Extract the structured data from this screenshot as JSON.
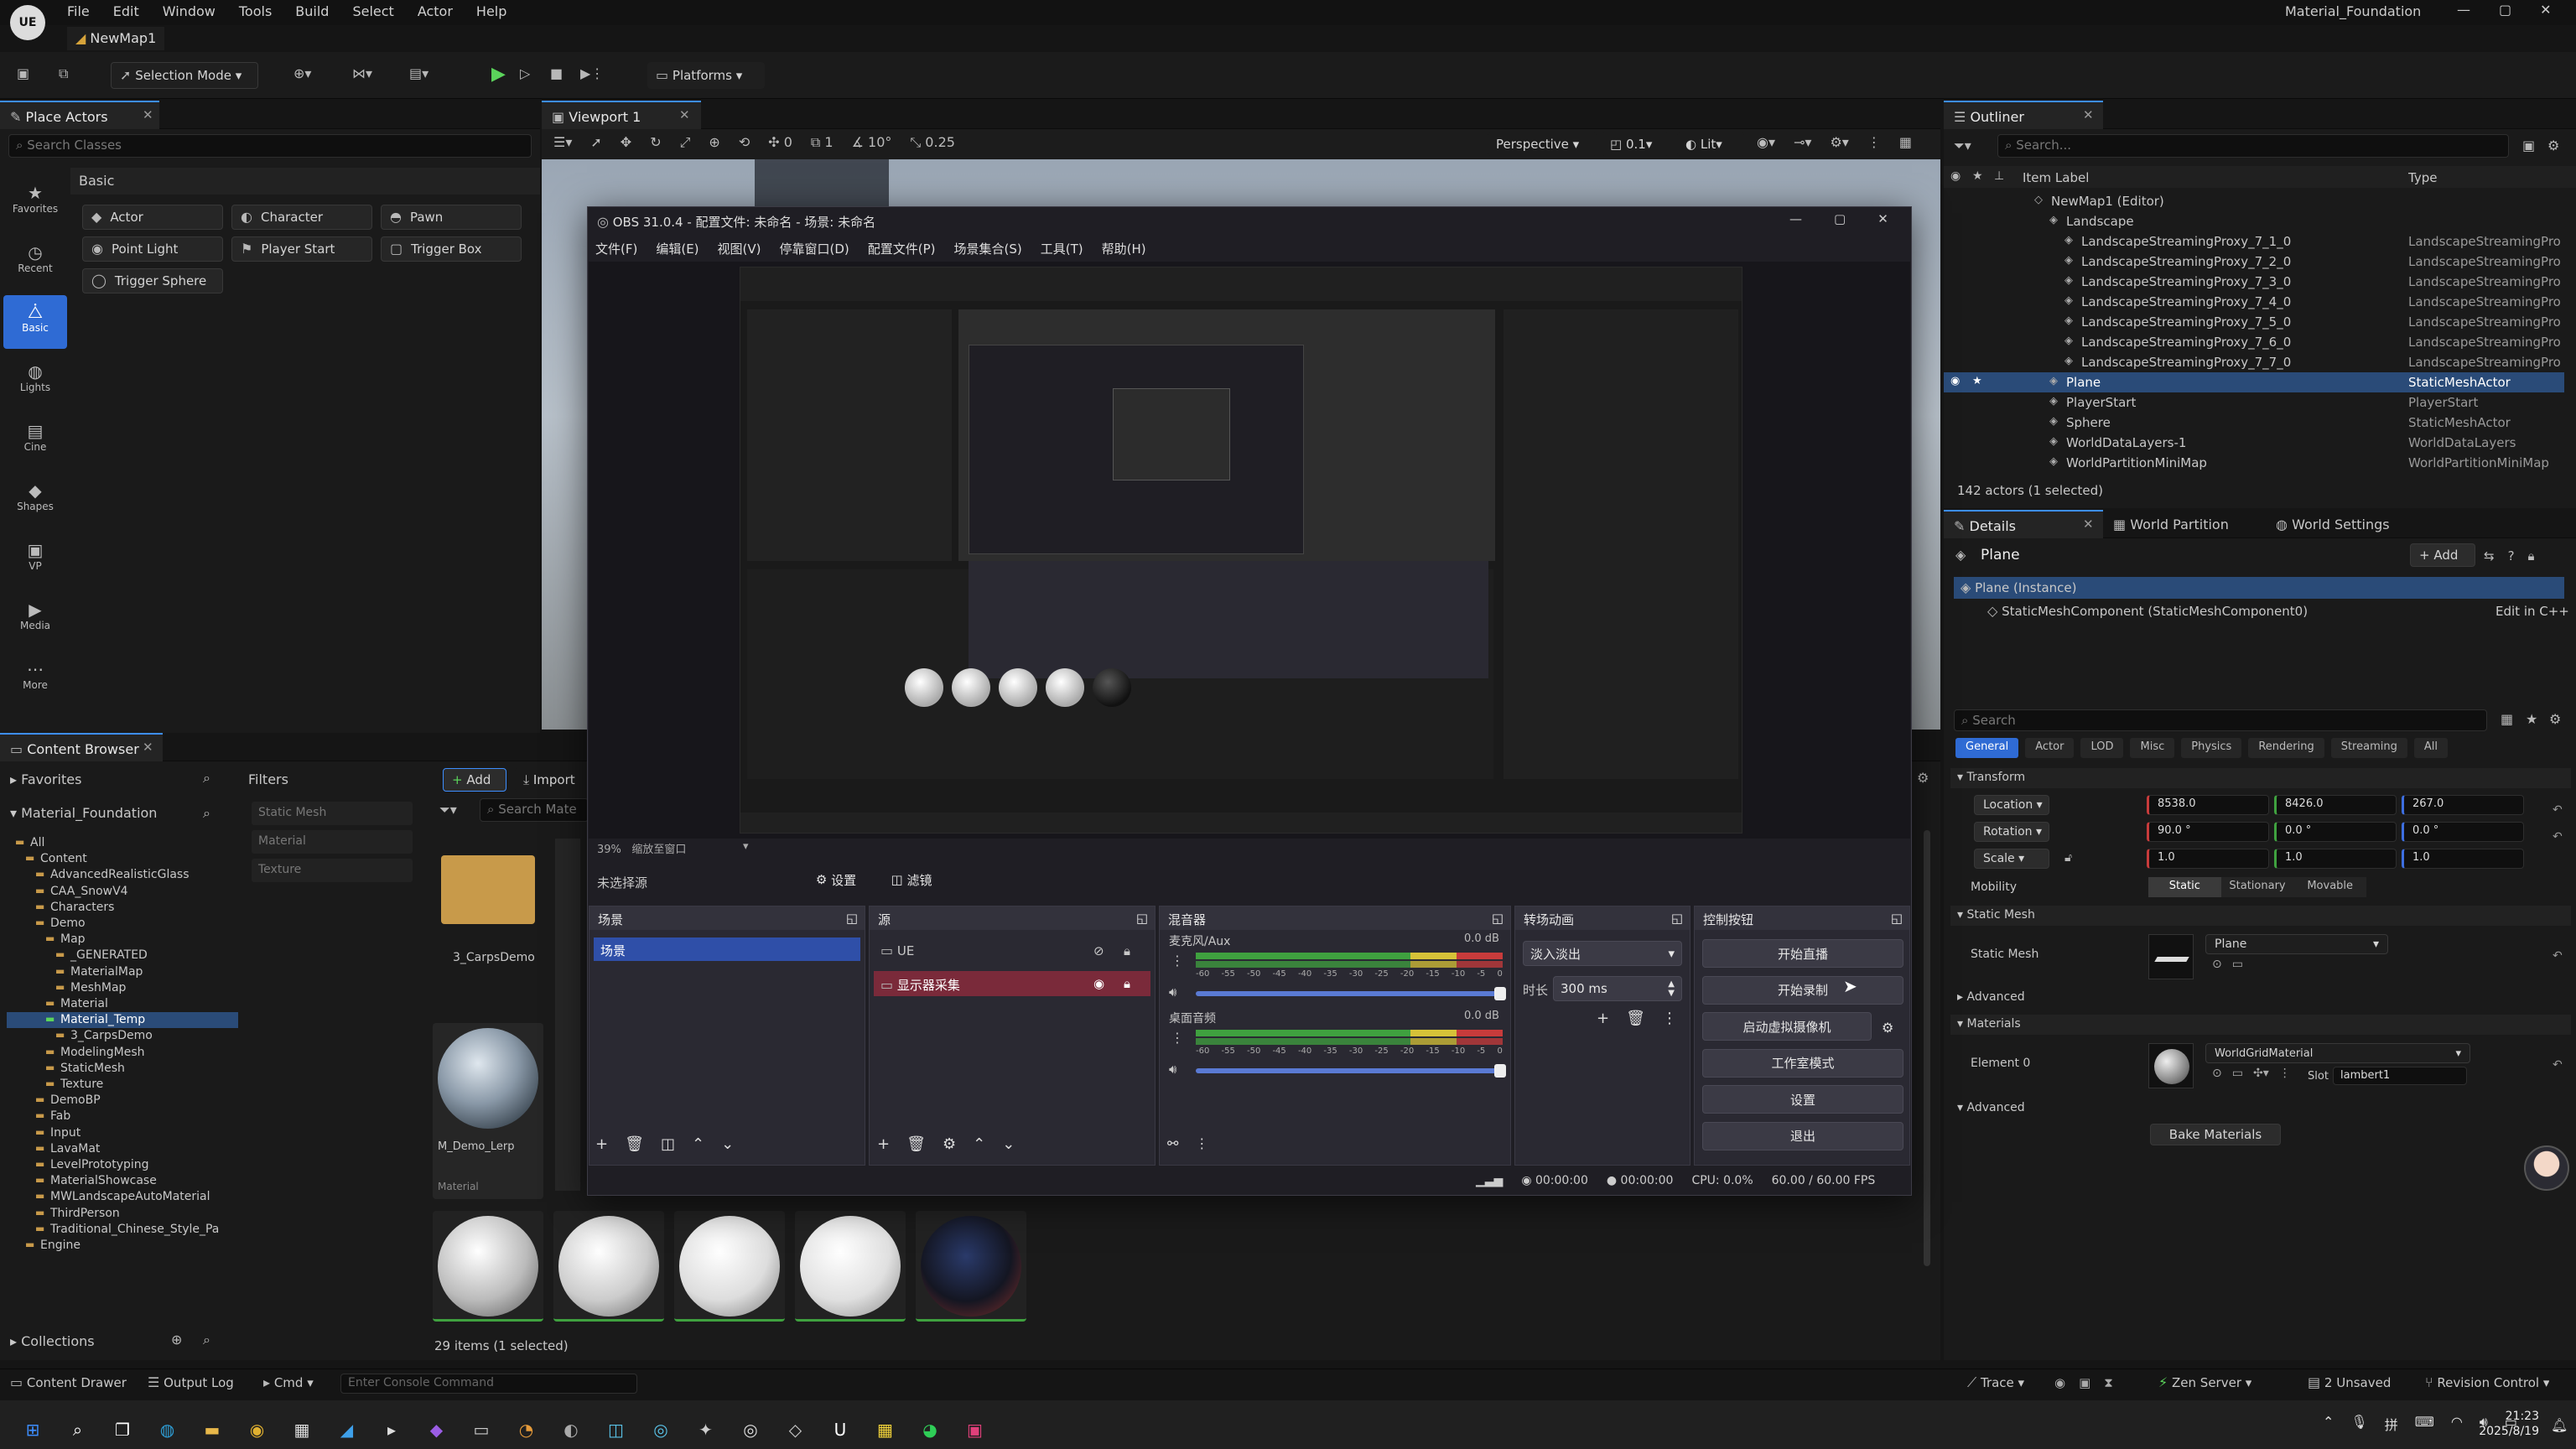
{
  "app": {
    "logo": "UE",
    "menus": [
      "File",
      "Edit",
      "Window",
      "Tools",
      "Build",
      "Select",
      "Actor",
      "Help"
    ],
    "project": "Material_Foundation",
    "map_tab": "NewMap1"
  },
  "toolbar": {
    "mode": "Selection Mode",
    "platforms": "Platforms"
  },
  "place_actors": {
    "tab": "Place Actors",
    "search_placeholder": "Search Classes",
    "category": "Basic",
    "sidebar": [
      {
        "label": "Favorites",
        "icon": "star-icon"
      },
      {
        "label": "Recent",
        "icon": "clock-icon"
      },
      {
        "label": "Basic",
        "icon": "basic-icon"
      },
      {
        "label": "Lights",
        "icon": "light-icon"
      },
      {
        "label": "Cine",
        "icon": "camera-icon"
      },
      {
        "label": "Shapes",
        "icon": "shapes-icon"
      },
      {
        "label": "VP",
        "icon": "vp-icon"
      },
      {
        "label": "Media",
        "icon": "media-icon"
      },
      {
        "label": "More",
        "icon": "more-icon"
      }
    ],
    "items": [
      "Actor",
      "Character",
      "Pawn",
      "Point Light",
      "Player Start",
      "Trigger Box",
      "Trigger Sphere"
    ]
  },
  "viewport": {
    "tab": "Viewport 1",
    "perspective": "Perspective",
    "lit": "Lit",
    "fov": "0.1",
    "snap_grid": "0",
    "snap_rot": "10°",
    "snap_scale": "0.25",
    "one": "1"
  },
  "outliner": {
    "tab": "Outliner",
    "search_placeholder": "Search...",
    "col_label": "Item Label",
    "col_type": "Type",
    "rows": [
      {
        "label": "NewMap1 (Editor)",
        "type": "",
        "indent": 0
      },
      {
        "label": "Landscape",
        "type": "",
        "indent": 1
      },
      {
        "label": "LandscapeStreamingProxy_7_1_0",
        "type": "LandscapeStreamingPro",
        "indent": 2
      },
      {
        "label": "LandscapeStreamingProxy_7_2_0",
        "type": "LandscapeStreamingPro",
        "indent": 2
      },
      {
        "label": "LandscapeStreamingProxy_7_3_0",
        "type": "LandscapeStreamingPro",
        "indent": 2
      },
      {
        "label": "LandscapeStreamingProxy_7_4_0",
        "type": "LandscapeStreamingPro",
        "indent": 2
      },
      {
        "label": "LandscapeStreamingProxy_7_5_0",
        "type": "LandscapeStreamingPro",
        "indent": 2
      },
      {
        "label": "LandscapeStreamingProxy_7_6_0",
        "type": "LandscapeStreamingPro",
        "indent": 2
      },
      {
        "label": "LandscapeStreamingProxy_7_7_0",
        "type": "LandscapeStreamingPro",
        "indent": 2
      },
      {
        "label": "Plane",
        "type": "StaticMeshActor",
        "indent": 1,
        "selected": true
      },
      {
        "label": "PlayerStart",
        "type": "PlayerStart",
        "indent": 1
      },
      {
        "label": "Sphere",
        "type": "StaticMeshActor",
        "indent": 1
      },
      {
        "label": "WorldDataLayers-1",
        "type": "WorldDataLayers",
        "indent": 1
      },
      {
        "label": "WorldPartitionMiniMap",
        "type": "WorldPartitionMiniMap",
        "indent": 1
      }
    ],
    "status": "142 actors (1 selected)"
  },
  "details": {
    "tabs": [
      "Details",
      "World Partition",
      "World Settings"
    ],
    "object": "Plane",
    "add": "Add",
    "instance": "Plane (Instance)",
    "component": "StaticMeshComponent (StaticMeshComponent0)",
    "edit_cpp": "Edit in C++",
    "search_placeholder": "Search",
    "filter_tabs": [
      "General",
      "Actor",
      "LOD",
      "Misc",
      "Physics",
      "Rendering",
      "Streaming",
      "All"
    ],
    "transform": "Transform",
    "location": "Location",
    "rotation": "Rotation",
    "scale": "Scale",
    "loc": [
      "8538.0",
      "8426.0",
      "267.0"
    ],
    "rot": [
      "90.0 °",
      "0.0 °",
      "0.0 °"
    ],
    "scl": [
      "1.0",
      "1.0",
      "1.0"
    ],
    "mobility": "Mobility",
    "mob_opts": [
      "Static",
      "Stationary",
      "Movable"
    ],
    "static_mesh_section": "Static Mesh",
    "static_mesh_label": "Static Mesh",
    "mesh_value": "Plane",
    "advanced": "Advanced",
    "materials": "Materials",
    "element0": "Element 0",
    "material_value": "WorldGridMaterial",
    "slot": "Slot",
    "slot_value": "lambert1",
    "bake": "Bake Materials"
  },
  "content_browser": {
    "tab": "Content Browser",
    "favorites": "Favorites",
    "project": "Material_Foundation",
    "filters": "Filters",
    "add": "Add",
    "import": "Import",
    "search_placeholder": "Search Mate",
    "filter_items": [
      "Static Mesh",
      "Material",
      "Texture"
    ],
    "tree": [
      {
        "label": "All",
        "indent": 0
      },
      {
        "label": "Content",
        "indent": 1
      },
      {
        "label": "AdvancedRealisticGlass",
        "indent": 2
      },
      {
        "label": "CAA_SnowV4",
        "indent": 2
      },
      {
        "label": "Characters",
        "indent": 2
      },
      {
        "label": "Demo",
        "indent": 2
      },
      {
        "label": "Map",
        "indent": 3
      },
      {
        "label": "_GENERATED",
        "indent": 4
      },
      {
        "label": "MaterialMap",
        "indent": 4
      },
      {
        "label": "MeshMap",
        "indent": 4
      },
      {
        "label": "Material",
        "indent": 3
      },
      {
        "label": "Material_Temp",
        "indent": 3,
        "selected": true
      },
      {
        "label": "3_CarpsDemo",
        "indent": 4
      },
      {
        "label": "ModelingMesh",
        "indent": 3
      },
      {
        "label": "StaticMesh",
        "indent": 3
      },
      {
        "label": "Texture",
        "indent": 3
      },
      {
        "label": "DemoBP",
        "indent": 2
      },
      {
        "label": "Fab",
        "indent": 2
      },
      {
        "label": "Input",
        "indent": 2
      },
      {
        "label": "LavaMat",
        "indent": 2
      },
      {
        "label": "LevelPrototyping",
        "indent": 2
      },
      {
        "label": "MaterialShowcase",
        "indent": 2
      },
      {
        "label": "MWLandscapeAutoMaterial",
        "indent": 2
      },
      {
        "label": "ThirdPerson",
        "indent": 2
      },
      {
        "label": "Traditional_Chinese_Style_Pa",
        "indent": 2
      },
      {
        "label": "Engine",
        "indent": 1
      }
    ],
    "assets": [
      {
        "label": "3_CarpsDemo",
        "type": ""
      },
      {
        "label": "M_Demo_Lerp",
        "type": "Material"
      }
    ],
    "collections": "Collections",
    "status": "29 items (1 selected)"
  },
  "obs": {
    "title": "OBS 31.0.4 - 配置文件: 未命名 - 场景: 未命名",
    "menus": [
      "文件(F)",
      "编辑(E)",
      "视图(V)",
      "停靠窗口(D)",
      "配置文件(P)",
      "场景集合(S)",
      "工具(T)",
      "帮助(H)"
    ],
    "zoom": "39%",
    "zoom_label": "缩放至窗口",
    "no_source": "未选择源",
    "settings_btn": "设置",
    "filters_btn": "滤镜",
    "docks": {
      "scenes": "场景",
      "sources": "源",
      "mixer": "混音器",
      "transitions": "转场动画",
      "controls": "控制按钮"
    },
    "scene_item": "场景",
    "sources_list": [
      "UE",
      "显示器采集"
    ],
    "mixer": [
      {
        "name": "麦克风/Aux",
        "db": "0.0 dB"
      },
      {
        "name": "桌面音频",
        "db": "0.0 dB"
      }
    ],
    "scale_ticks": [
      "-60",
      "-55",
      "-50",
      "-45",
      "-40",
      "-35",
      "-30",
      "-25",
      "-20",
      "-15",
      "-10",
      "-5",
      "0"
    ],
    "transition": "淡入淡出",
    "duration_label": "时长",
    "duration": "300 ms",
    "controls": [
      "开始直播",
      "开始录制",
      "启动虚拟摄像机",
      "工作室模式",
      "设置",
      "退出"
    ],
    "status": {
      "t1": "00:00:00",
      "t2": "00:00:00",
      "cpu": "CPU: 0.0%",
      "fps": "60.00 / 60.00 FPS"
    }
  },
  "bottom": {
    "drawer": "Content Drawer",
    "output": "Output Log",
    "cmd": "Cmd",
    "console_placeholder": "Enter Console Command",
    "trace": "Trace",
    "zen": "Zen Server",
    "unsaved": "2 Unsaved",
    "revision": "Revision Control"
  },
  "taskbar": {
    "time": "21:23",
    "date": "2025/8/19"
  },
  "colors": {
    "accent": "#3d8eff",
    "selection": "#2a4b78",
    "obs_bg": "#1f1e24",
    "record_red": "#c83b3b"
  }
}
